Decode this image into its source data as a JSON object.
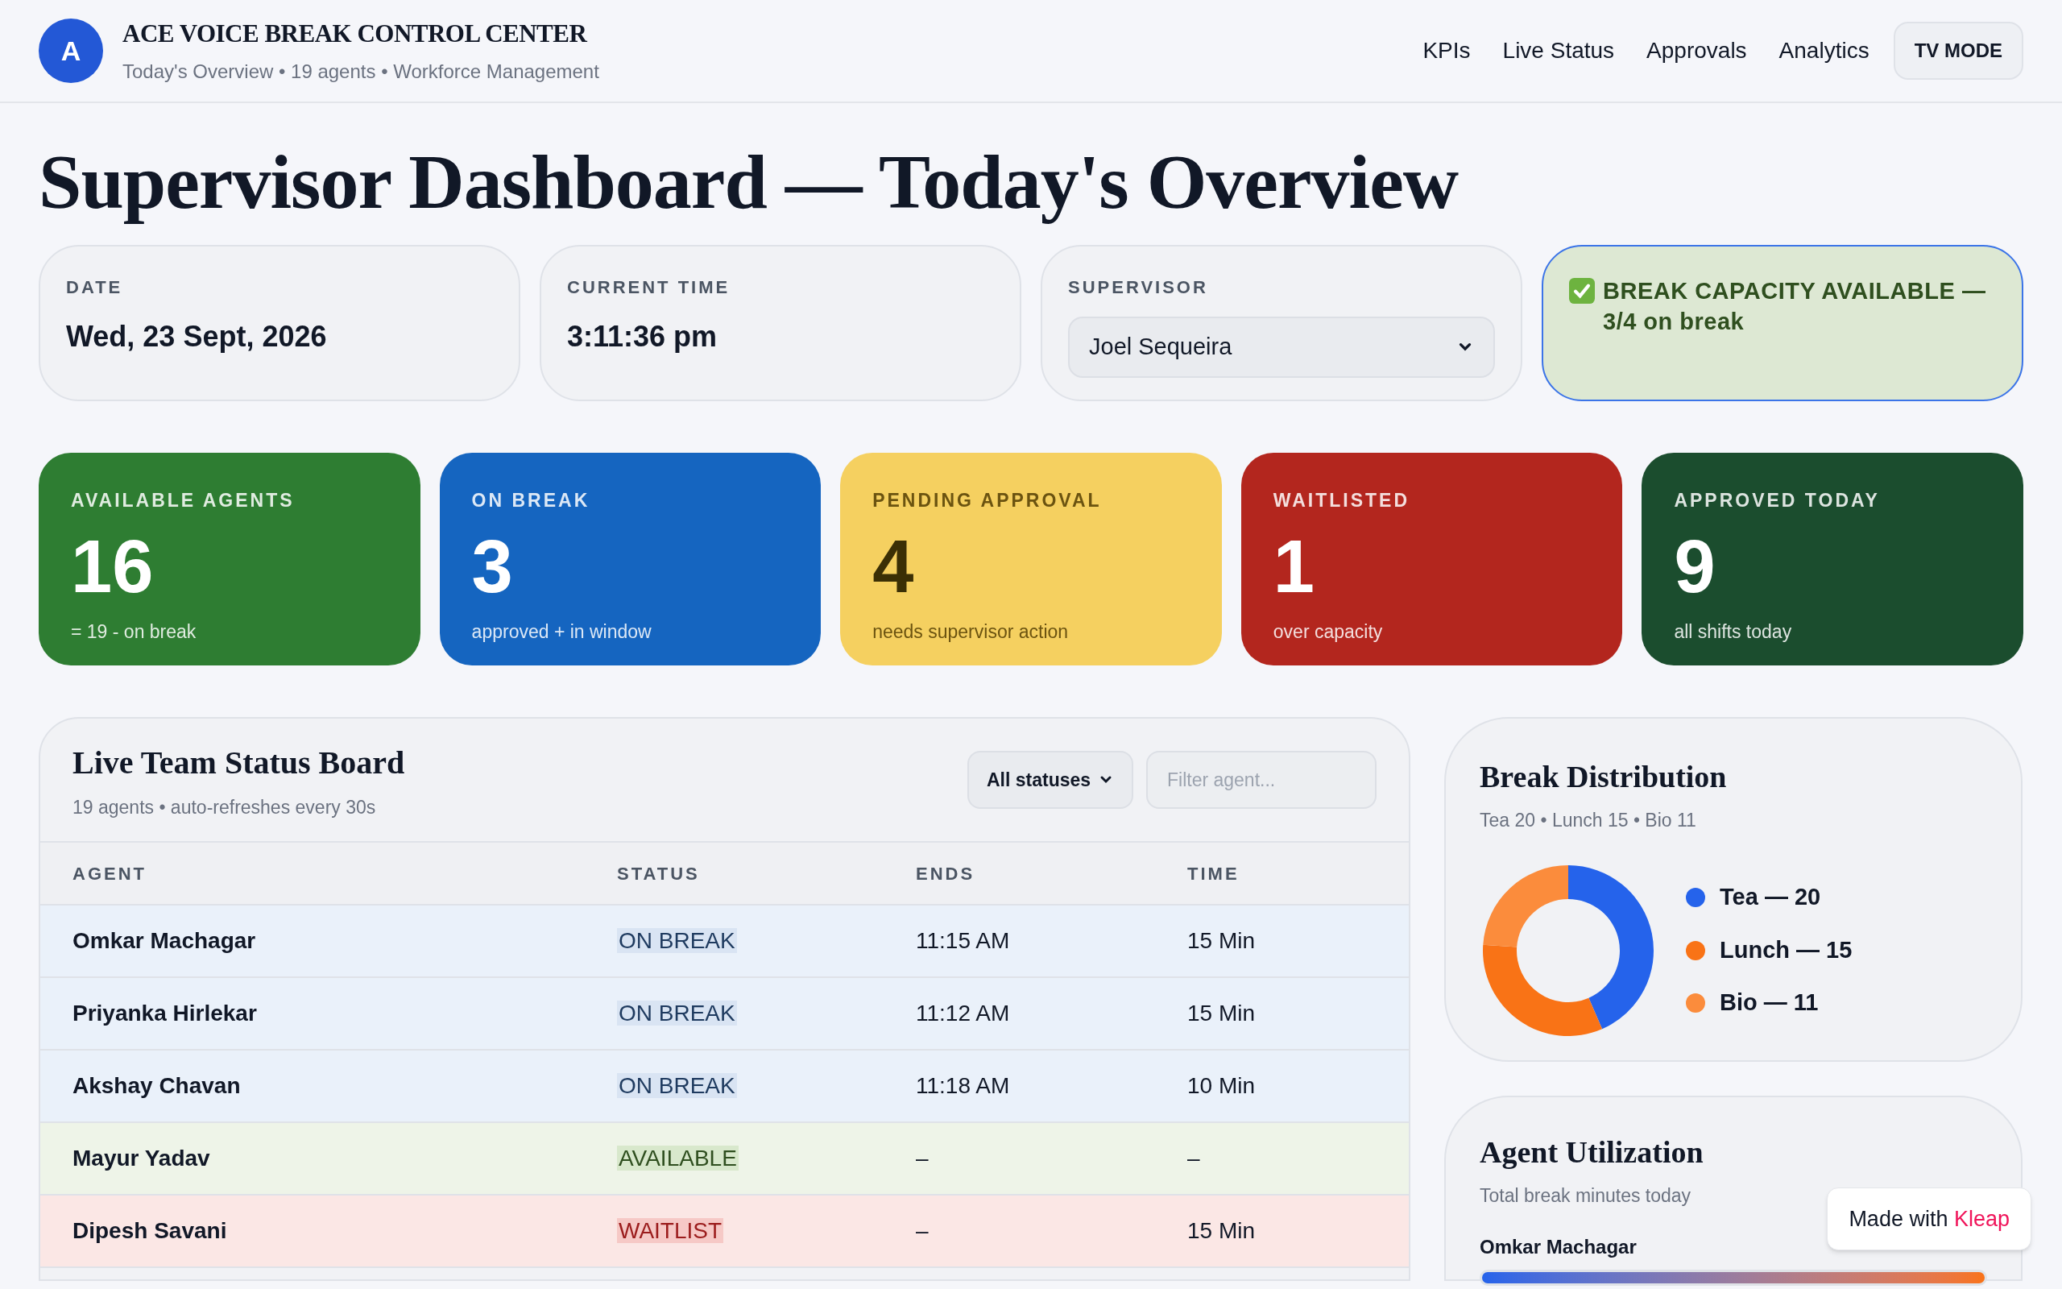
{
  "header": {
    "logo_letter": "A",
    "title": "ACE VOICE BREAK CONTROL CENTER",
    "subtitle": "Today's Overview • 19 agents • Workforce Management",
    "nav": [
      "KPIs",
      "Live Status",
      "Approvals",
      "Analytics"
    ],
    "tv_button": "TV MODE"
  },
  "heading": "Supervisor Dashboard — Today's Overview",
  "info_cards": [
    {
      "kind": "text",
      "label": "DATE",
      "value": "Wed, 23 Sept, 2026"
    },
    {
      "kind": "text",
      "label": "CURRENT TIME",
      "value": "3:11:36 pm"
    },
    {
      "kind": "select",
      "label": "SUPERVISOR",
      "value": "Joel Sequeira"
    }
  ],
  "capacity_banner": {
    "text": "BREAK CAPACITY AVAILABLE — 3/4 on break"
  },
  "stats": [
    {
      "label": "AVAILABLE AGENTS",
      "value": "16",
      "note": "= 19 - on break",
      "color": "#2e7d32"
    },
    {
      "label": "ON BREAK",
      "value": "3",
      "note": "approved + in window",
      "color": "#1565c0"
    },
    {
      "label": "PENDING APPROVAL",
      "value": "4",
      "note": "needs supervisor action",
      "color": "#f5d060"
    },
    {
      "label": "WAITLISTED",
      "value": "1",
      "note": "over capacity",
      "color": "#b3261e"
    },
    {
      "label": "APPROVED TODAY",
      "value": "9",
      "note": "all shifts today",
      "color": "#1b4d2e"
    }
  ],
  "team_board": {
    "title": "Live Team Status Board",
    "subtitle": "19 agents • auto-refreshes every 30s",
    "status_filter": "All statuses",
    "filter_placeholder": "Filter agent...",
    "columns": [
      "AGENT",
      "STATUS",
      "ENDS",
      "TIME"
    ],
    "rows": [
      {
        "agent": "Omkar Machagar",
        "status": "ON BREAK",
        "kind": "on_break",
        "ends": "11:15 AM",
        "time": "15 Min"
      },
      {
        "agent": "Priyanka Hirlekar",
        "status": "ON BREAK",
        "kind": "on_break",
        "ends": "11:12 AM",
        "time": "15 Min"
      },
      {
        "agent": "Akshay Chavan",
        "status": "ON BREAK",
        "kind": "on_break",
        "ends": "11:18 AM",
        "time": "10 Min"
      },
      {
        "agent": "Mayur Yadav",
        "status": "AVAILABLE",
        "kind": "available",
        "ends": "–",
        "time": "–"
      },
      {
        "agent": "Dipesh Savani",
        "status": "WAITLIST",
        "kind": "waitlist",
        "ends": "–",
        "time": "15 Min"
      }
    ]
  },
  "break_distribution": {
    "title": "Break Distribution",
    "subtitle": "Tea 20 • Lunch 15 • Bio 11",
    "chart_data": {
      "type": "donut",
      "categories": [
        "Tea",
        "Lunch",
        "Bio"
      ],
      "series": [
        {
          "values": [
            43.5,
            32.6,
            23.9
          ]
        }
      ]
    },
    "legend_separator": "—",
    "legend": [
      {
        "value": "20",
        "color": "#2563eb"
      },
      {
        "value": "15",
        "color": "#f97316"
      },
      {
        "value": "11",
        "color": "#fb8c3c"
      }
    ]
  },
  "utilization": {
    "title": "Agent Utilization",
    "subtitle": "Total break minutes today",
    "agents": [
      {
        "name": "Omkar Machagar",
        "level": 1
      }
    ]
  },
  "badge": {
    "text": "Made with",
    "brand": "Kleap"
  }
}
